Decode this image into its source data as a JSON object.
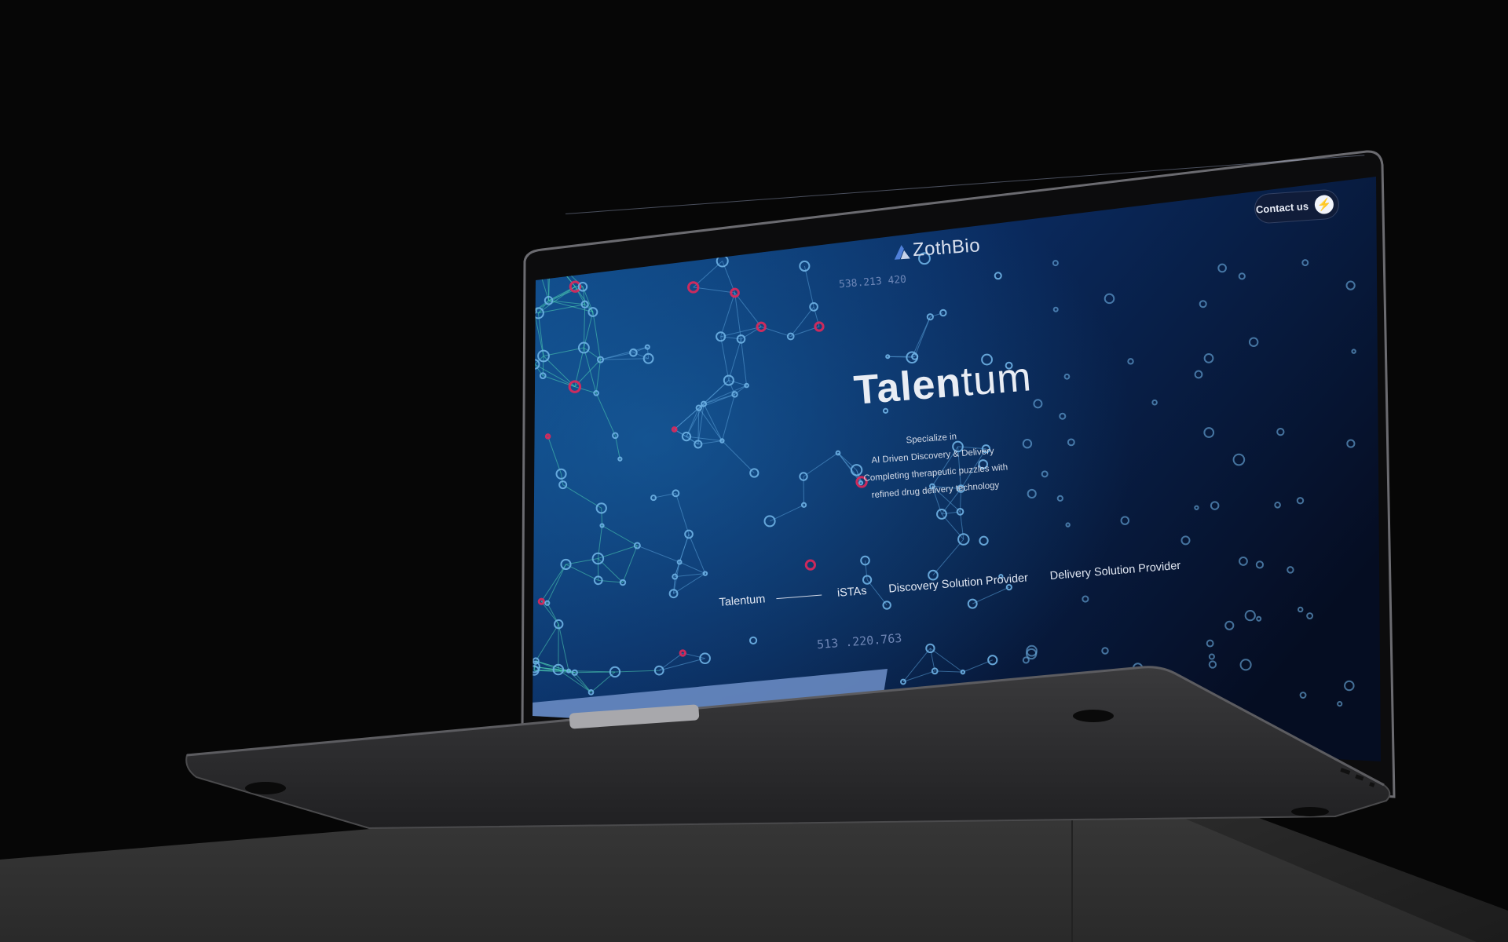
{
  "site": {
    "logo_text": "ZothBio",
    "contact_label": "Contact us",
    "contact_icon": "lightning-icon",
    "hero": {
      "title_bold": "Talen",
      "title_light": "tum",
      "lines": [
        "Specialize in",
        "AI Driven Discovery & Delivery",
        "Completing therapeutic puzzles with",
        "refined drug delivery technology"
      ]
    },
    "tabs": [
      "Talentum",
      "iSTAs",
      "Discovery Solution Provider",
      "Delivery Solution Provider"
    ],
    "coords": {
      "top": "538.213 420",
      "bottom": "513 .220.763"
    }
  },
  "colors": {
    "accent": "#1a5fd8",
    "network_node": "#6fb2e6",
    "network_highlight": "#e0285a",
    "screen_bg": "#0a1f4a"
  }
}
